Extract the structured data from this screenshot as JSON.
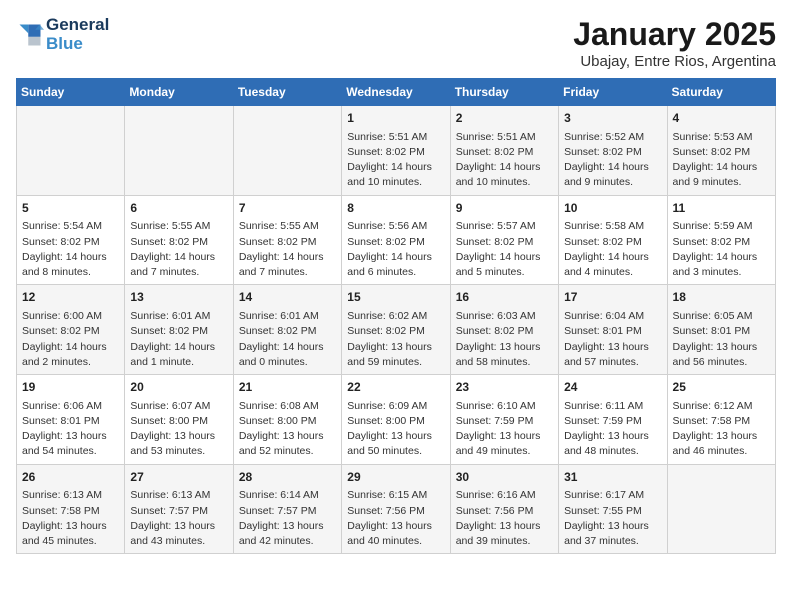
{
  "header": {
    "logo_line1": "General",
    "logo_line2": "Blue",
    "title": "January 2025",
    "subtitle": "Ubajay, Entre Rios, Argentina"
  },
  "days_of_week": [
    "Sunday",
    "Monday",
    "Tuesday",
    "Wednesday",
    "Thursday",
    "Friday",
    "Saturday"
  ],
  "weeks": [
    [
      {
        "day": "",
        "content": ""
      },
      {
        "day": "",
        "content": ""
      },
      {
        "day": "",
        "content": ""
      },
      {
        "day": "1",
        "content": "Sunrise: 5:51 AM\nSunset: 8:02 PM\nDaylight: 14 hours\nand 10 minutes."
      },
      {
        "day": "2",
        "content": "Sunrise: 5:51 AM\nSunset: 8:02 PM\nDaylight: 14 hours\nand 10 minutes."
      },
      {
        "day": "3",
        "content": "Sunrise: 5:52 AM\nSunset: 8:02 PM\nDaylight: 14 hours\nand 9 minutes."
      },
      {
        "day": "4",
        "content": "Sunrise: 5:53 AM\nSunset: 8:02 PM\nDaylight: 14 hours\nand 9 minutes."
      }
    ],
    [
      {
        "day": "5",
        "content": "Sunrise: 5:54 AM\nSunset: 8:02 PM\nDaylight: 14 hours\nand 8 minutes."
      },
      {
        "day": "6",
        "content": "Sunrise: 5:55 AM\nSunset: 8:02 PM\nDaylight: 14 hours\nand 7 minutes."
      },
      {
        "day": "7",
        "content": "Sunrise: 5:55 AM\nSunset: 8:02 PM\nDaylight: 14 hours\nand 7 minutes."
      },
      {
        "day": "8",
        "content": "Sunrise: 5:56 AM\nSunset: 8:02 PM\nDaylight: 14 hours\nand 6 minutes."
      },
      {
        "day": "9",
        "content": "Sunrise: 5:57 AM\nSunset: 8:02 PM\nDaylight: 14 hours\nand 5 minutes."
      },
      {
        "day": "10",
        "content": "Sunrise: 5:58 AM\nSunset: 8:02 PM\nDaylight: 14 hours\nand 4 minutes."
      },
      {
        "day": "11",
        "content": "Sunrise: 5:59 AM\nSunset: 8:02 PM\nDaylight: 14 hours\nand 3 minutes."
      }
    ],
    [
      {
        "day": "12",
        "content": "Sunrise: 6:00 AM\nSunset: 8:02 PM\nDaylight: 14 hours\nand 2 minutes."
      },
      {
        "day": "13",
        "content": "Sunrise: 6:01 AM\nSunset: 8:02 PM\nDaylight: 14 hours\nand 1 minute."
      },
      {
        "day": "14",
        "content": "Sunrise: 6:01 AM\nSunset: 8:02 PM\nDaylight: 14 hours\nand 0 minutes."
      },
      {
        "day": "15",
        "content": "Sunrise: 6:02 AM\nSunset: 8:02 PM\nDaylight: 13 hours\nand 59 minutes."
      },
      {
        "day": "16",
        "content": "Sunrise: 6:03 AM\nSunset: 8:02 PM\nDaylight: 13 hours\nand 58 minutes."
      },
      {
        "day": "17",
        "content": "Sunrise: 6:04 AM\nSunset: 8:01 PM\nDaylight: 13 hours\nand 57 minutes."
      },
      {
        "day": "18",
        "content": "Sunrise: 6:05 AM\nSunset: 8:01 PM\nDaylight: 13 hours\nand 56 minutes."
      }
    ],
    [
      {
        "day": "19",
        "content": "Sunrise: 6:06 AM\nSunset: 8:01 PM\nDaylight: 13 hours\nand 54 minutes."
      },
      {
        "day": "20",
        "content": "Sunrise: 6:07 AM\nSunset: 8:00 PM\nDaylight: 13 hours\nand 53 minutes."
      },
      {
        "day": "21",
        "content": "Sunrise: 6:08 AM\nSunset: 8:00 PM\nDaylight: 13 hours\nand 52 minutes."
      },
      {
        "day": "22",
        "content": "Sunrise: 6:09 AM\nSunset: 8:00 PM\nDaylight: 13 hours\nand 50 minutes."
      },
      {
        "day": "23",
        "content": "Sunrise: 6:10 AM\nSunset: 7:59 PM\nDaylight: 13 hours\nand 49 minutes."
      },
      {
        "day": "24",
        "content": "Sunrise: 6:11 AM\nSunset: 7:59 PM\nDaylight: 13 hours\nand 48 minutes."
      },
      {
        "day": "25",
        "content": "Sunrise: 6:12 AM\nSunset: 7:58 PM\nDaylight: 13 hours\nand 46 minutes."
      }
    ],
    [
      {
        "day": "26",
        "content": "Sunrise: 6:13 AM\nSunset: 7:58 PM\nDaylight: 13 hours\nand 45 minutes."
      },
      {
        "day": "27",
        "content": "Sunrise: 6:13 AM\nSunset: 7:57 PM\nDaylight: 13 hours\nand 43 minutes."
      },
      {
        "day": "28",
        "content": "Sunrise: 6:14 AM\nSunset: 7:57 PM\nDaylight: 13 hours\nand 42 minutes."
      },
      {
        "day": "29",
        "content": "Sunrise: 6:15 AM\nSunset: 7:56 PM\nDaylight: 13 hours\nand 40 minutes."
      },
      {
        "day": "30",
        "content": "Sunrise: 6:16 AM\nSunset: 7:56 PM\nDaylight: 13 hours\nand 39 minutes."
      },
      {
        "day": "31",
        "content": "Sunrise: 6:17 AM\nSunset: 7:55 PM\nDaylight: 13 hours\nand 37 minutes."
      },
      {
        "day": "",
        "content": ""
      }
    ]
  ]
}
